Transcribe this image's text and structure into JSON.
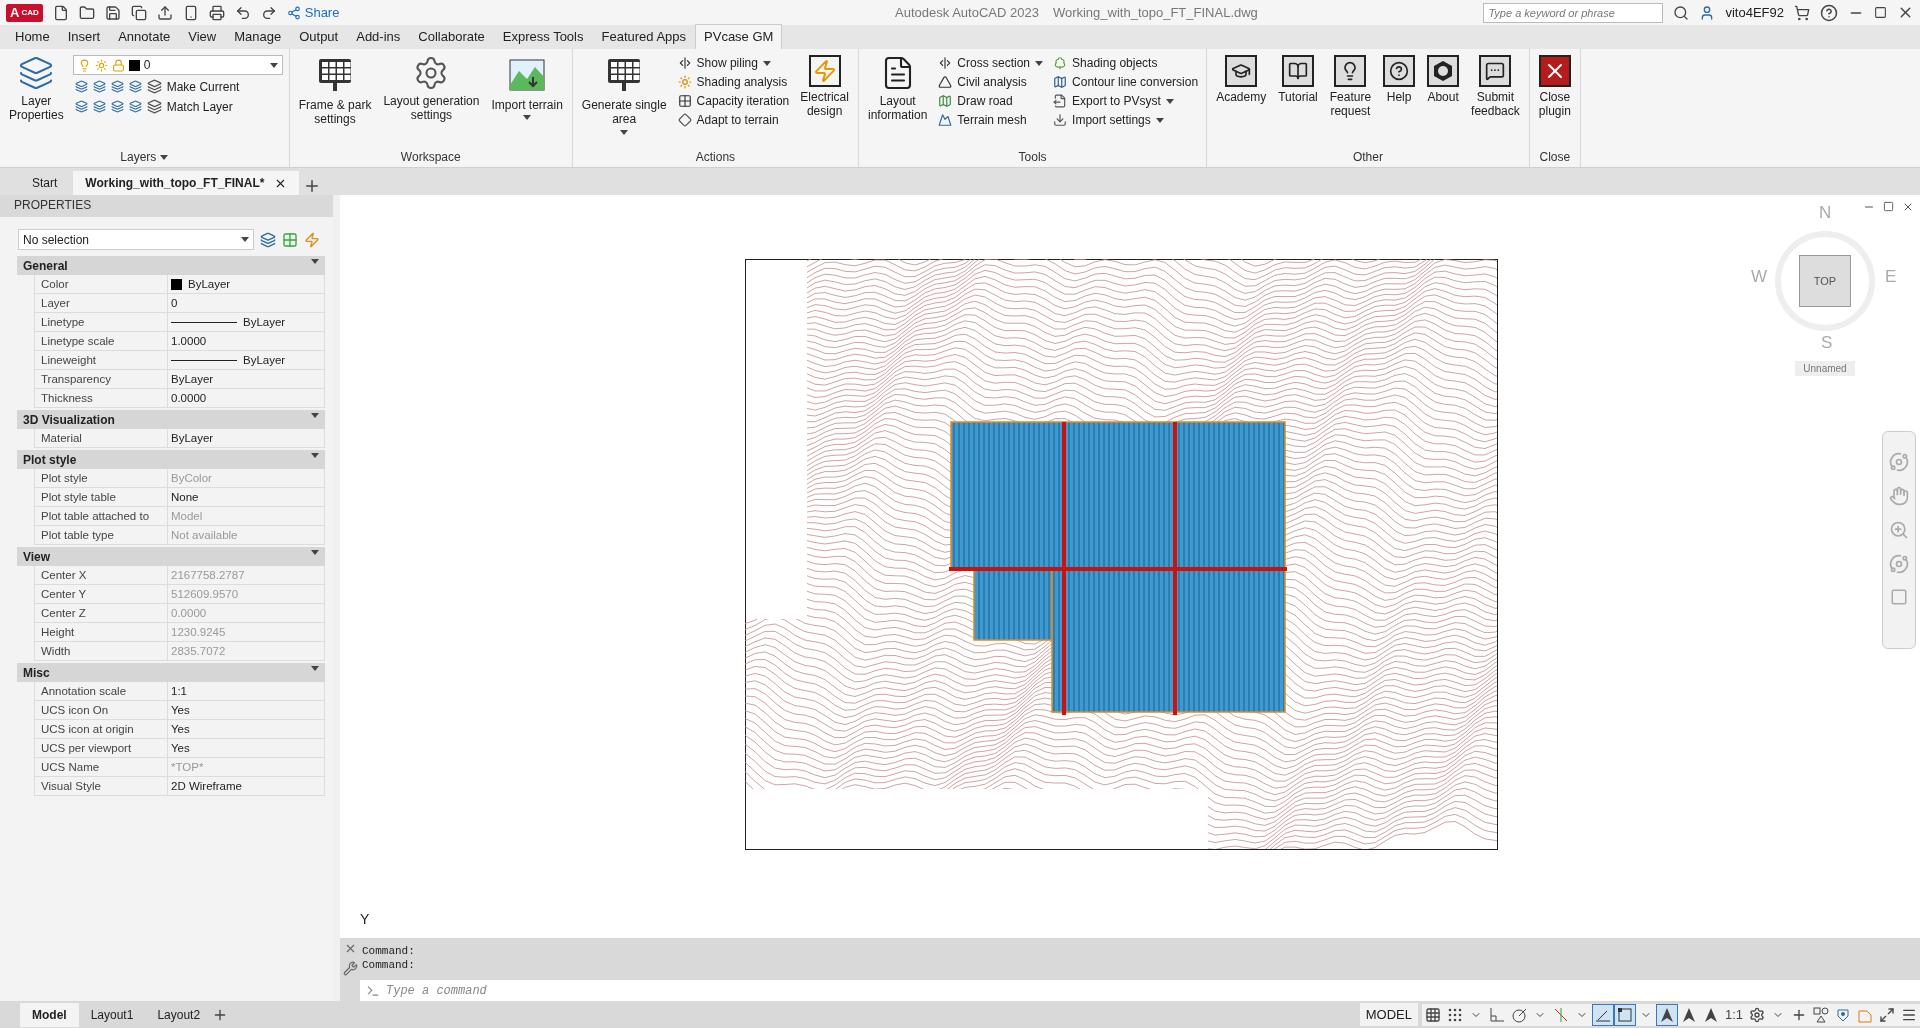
{
  "title_bar": {
    "logo_letter": "A",
    "logo_label": "CAD",
    "share": "Share",
    "app_title": "Autodesk AutoCAD 2023",
    "file_name": "Working_with_topo_FT_FINAL.dwg",
    "search_placeholder": "Type a keyword or phrase",
    "user": "vito4EF92"
  },
  "ribbon_tabs": [
    {
      "label": "Home",
      "selected": false
    },
    {
      "label": "Insert",
      "selected": false
    },
    {
      "label": "Annotate",
      "selected": false
    },
    {
      "label": "View",
      "selected": false
    },
    {
      "label": "Manage",
      "selected": false
    },
    {
      "label": "Output",
      "selected": false
    },
    {
      "label": "Add-ins",
      "selected": false
    },
    {
      "label": "Collaborate",
      "selected": false
    },
    {
      "label": "Express Tools",
      "selected": false
    },
    {
      "label": "Featured Apps",
      "selected": false
    },
    {
      "label": "PVcase GM",
      "selected": true
    }
  ],
  "ribbon_panels": [
    {
      "title": "Layers",
      "dropdown": true,
      "items": [
        {
          "kind": "large",
          "label": "Layer\nProperties",
          "dropdown": false
        },
        {
          "kind": "layers",
          "current_layer": "0",
          "actions": [
            "Make Current",
            "Match Layer"
          ]
        }
      ]
    },
    {
      "title": "Workspace",
      "dropdown": false,
      "items": [
        {
          "kind": "large",
          "label": "Frame & park\nsettings",
          "dropdown": false
        },
        {
          "kind": "large",
          "label": "Layout generation\nsettings",
          "dropdown": false
        },
        {
          "kind": "large",
          "label": "Import terrain",
          "dropdown": true
        }
      ]
    },
    {
      "title": "Actions",
      "dropdown": false,
      "items": [
        {
          "kind": "large",
          "label": "Generate single\narea",
          "dropdown": true
        },
        {
          "kind": "stack",
          "items": [
            {
              "label": "Show piling",
              "dropdown": true
            },
            {
              "label": "Shading analysis",
              "dropdown": false
            },
            {
              "label": "Capacity iteration",
              "dropdown": false
            },
            {
              "label": "Adapt to terrain",
              "dropdown": false
            }
          ]
        },
        {
          "kind": "large",
          "label": "Electrical\ndesign",
          "dropdown": false
        }
      ]
    },
    {
      "title": "Tools",
      "dropdown": false,
      "items": [
        {
          "kind": "large",
          "label": "Layout\ninformation",
          "dropdown": false
        },
        {
          "kind": "stack",
          "items": [
            {
              "label": "Cross section",
              "dropdown": true
            },
            {
              "label": "Civil analysis",
              "dropdown": false
            },
            {
              "label": "Draw road",
              "dropdown": false
            },
            {
              "label": "Terrain mesh",
              "dropdown": false
            }
          ]
        },
        {
          "kind": "stack",
          "items": [
            {
              "label": "Shading objects",
              "dropdown": false
            },
            {
              "label": "Contour line conversion",
              "dropdown": false
            },
            {
              "label": "Export to PVsyst",
              "dropdown": true
            },
            {
              "label": "Import settings",
              "dropdown": true
            }
          ]
        }
      ]
    },
    {
      "title": "Other",
      "dropdown": false,
      "items": [
        {
          "kind": "framed",
          "label": "Academy",
          "dropdown": false
        },
        {
          "kind": "framed",
          "label": "Tutorial",
          "dropdown": false
        },
        {
          "kind": "framed",
          "label": "Feature\nrequest",
          "dropdown": false
        },
        {
          "kind": "framed",
          "label": "Help",
          "dropdown": false
        },
        {
          "kind": "framed",
          "label": "About",
          "dropdown": false
        },
        {
          "kind": "framed",
          "label": "Submit\nfeedback",
          "dropdown": false
        }
      ]
    },
    {
      "title": "Close",
      "dropdown": false,
      "items": [
        {
          "kind": "framed",
          "label": "Close\nplugin",
          "dropdown": false
        }
      ]
    }
  ],
  "file_tabs": [
    {
      "label": "Start",
      "selected": false,
      "closable": false
    },
    {
      "label": "Working_with_topo_FT_FINAL*",
      "selected": true,
      "closable": true
    }
  ],
  "properties": {
    "title": "PROPERTIES",
    "selection": "No selection",
    "sections": [
      {
        "title": "General",
        "rows": [
          {
            "name": "Color",
            "value": "ByLayer",
            "kind": "swatch",
            "disabled": false
          },
          {
            "name": "Layer",
            "value": "0",
            "kind": "text",
            "disabled": false
          },
          {
            "name": "Linetype",
            "value": "ByLayer",
            "kind": "line",
            "disabled": false
          },
          {
            "name": "Linetype scale",
            "value": "1.0000",
            "kind": "text",
            "disabled": false
          },
          {
            "name": "Lineweight",
            "value": "ByLayer",
            "kind": "line",
            "disabled": false
          },
          {
            "name": "Transparency",
            "value": "ByLayer",
            "kind": "text",
            "disabled": false
          },
          {
            "name": "Thickness",
            "value": "0.0000",
            "kind": "text",
            "disabled": false
          }
        ]
      },
      {
        "title": "3D Visualization",
        "rows": [
          {
            "name": "Material",
            "value": "ByLayer",
            "kind": "text",
            "disabled": false
          }
        ]
      },
      {
        "title": "Plot style",
        "rows": [
          {
            "name": "Plot style",
            "value": "ByColor",
            "kind": "text",
            "disabled": true
          },
          {
            "name": "Plot style table",
            "value": "None",
            "kind": "text",
            "disabled": false
          },
          {
            "name": "Plot table attached to",
            "value": "Model",
            "kind": "text",
            "disabled": true
          },
          {
            "name": "Plot table type",
            "value": "Not available",
            "kind": "text",
            "disabled": true
          }
        ]
      },
      {
        "title": "View",
        "rows": [
          {
            "name": "Center X",
            "value": "2167758.2787",
            "kind": "text",
            "disabled": true
          },
          {
            "name": "Center Y",
            "value": "512609.9570",
            "kind": "text",
            "disabled": true
          },
          {
            "name": "Center Z",
            "value": "0.0000",
            "kind": "text",
            "disabled": true
          },
          {
            "name": "Height",
            "value": "1230.9245",
            "kind": "text",
            "disabled": true
          },
          {
            "name": "Width",
            "value": "2835.7072",
            "kind": "text",
            "disabled": true
          }
        ]
      },
      {
        "title": "Misc",
        "rows": [
          {
            "name": "Annotation scale",
            "value": "1:1",
            "kind": "text",
            "disabled": false
          },
          {
            "name": "UCS icon On",
            "value": "Yes",
            "kind": "text",
            "disabled": false
          },
          {
            "name": "UCS icon at origin",
            "value": "Yes",
            "kind": "text",
            "disabled": false
          },
          {
            "name": "UCS per viewport",
            "value": "Yes",
            "kind": "text",
            "disabled": false
          },
          {
            "name": "UCS Name",
            "value": "*TOP*",
            "kind": "text",
            "disabled": true
          },
          {
            "name": "Visual Style",
            "value": "2D Wireframe",
            "kind": "text",
            "disabled": false
          }
        ]
      }
    ]
  },
  "viewcube": {
    "north": "N",
    "south": "S",
    "east": "E",
    "west": "W",
    "face": "TOP",
    "view_name": "Unnamed"
  },
  "ucs_axis": "Y",
  "command_line": {
    "history": [
      "Command:",
      "Command:"
    ],
    "placeholder": "Type a command"
  },
  "layout_tabs": [
    {
      "label": "Model",
      "selected": true
    },
    {
      "label": "Layout1",
      "selected": false
    },
    {
      "label": "Layout2",
      "selected": false
    }
  ],
  "status_bar": {
    "space": "MODEL",
    "scale": "1:1",
    "toggles": [
      {
        "kind": "grid",
        "on": false
      },
      {
        "kind": "snap",
        "on": false
      },
      {
        "kind": "caret",
        "on": false
      },
      {
        "kind": "ortho",
        "on": false
      },
      {
        "kind": "polar",
        "on": false
      },
      {
        "kind": "caret",
        "on": false
      },
      {
        "kind": "isodraft",
        "on": false
      },
      {
        "kind": "caret",
        "on": false
      },
      {
        "kind": "tracking",
        "on": true
      },
      {
        "kind": "osnap",
        "on": true
      },
      {
        "kind": "caret",
        "on": false
      },
      {
        "kind": "annotation",
        "on": true
      },
      {
        "kind": "autoscale",
        "on": false
      },
      {
        "kind": "annoscale",
        "on": false
      },
      {
        "kind": "scale",
        "on": false
      },
      {
        "kind": "gear",
        "on": false
      },
      {
        "kind": "caret",
        "on": false
      },
      {
        "kind": "plus",
        "on": false
      },
      {
        "kind": "isolate",
        "on": false
      },
      {
        "kind": "hardware",
        "on": false
      },
      {
        "kind": "units",
        "on": false
      },
      {
        "kind": "fullscreen",
        "on": false
      },
      {
        "kind": "menu",
        "on": false
      }
    ]
  }
}
